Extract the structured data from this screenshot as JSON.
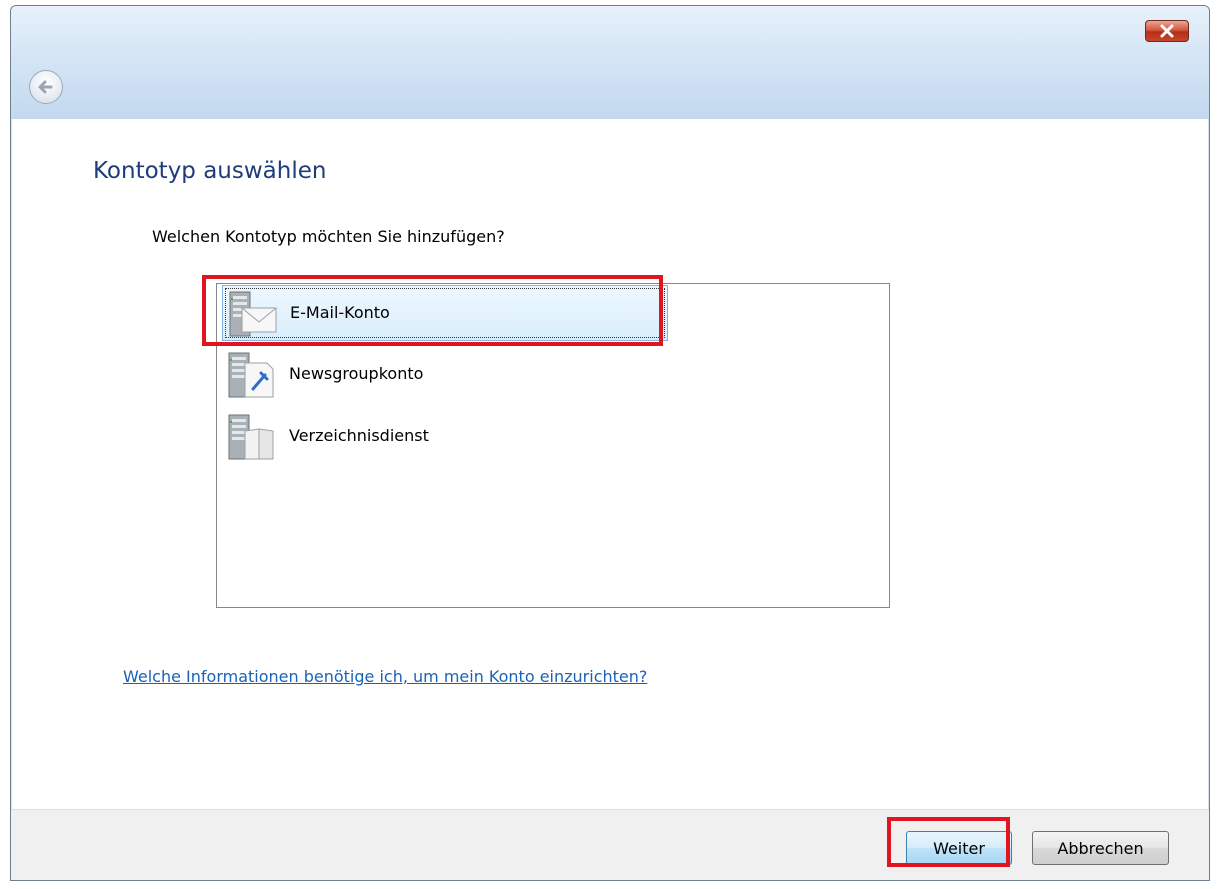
{
  "window": {
    "title": ""
  },
  "titlebar": {
    "close_icon": "close-icon",
    "back_icon": "back-arrow-icon"
  },
  "page": {
    "title": "Kontotyp auswählen",
    "question": "Welchen Kontotyp möchten Sie hinzufügen?"
  },
  "account_types": [
    {
      "label": "E-Mail-Konto",
      "icon": "email-server-icon",
      "selected": true
    },
    {
      "label": "Newsgroupkonto",
      "icon": "newsgroup-server-icon",
      "selected": false
    },
    {
      "label": "Verzeichnisdienst",
      "icon": "directory-server-icon",
      "selected": false
    }
  ],
  "help_link": "Welche Informationen benötige ich, um mein Konto einzurichten?",
  "buttons": {
    "next": "Weiter",
    "cancel": "Abbrechen"
  },
  "colors": {
    "accent_highlight": "#e0151f",
    "title_text": "#1e3c78",
    "link": "#1a62b8"
  }
}
